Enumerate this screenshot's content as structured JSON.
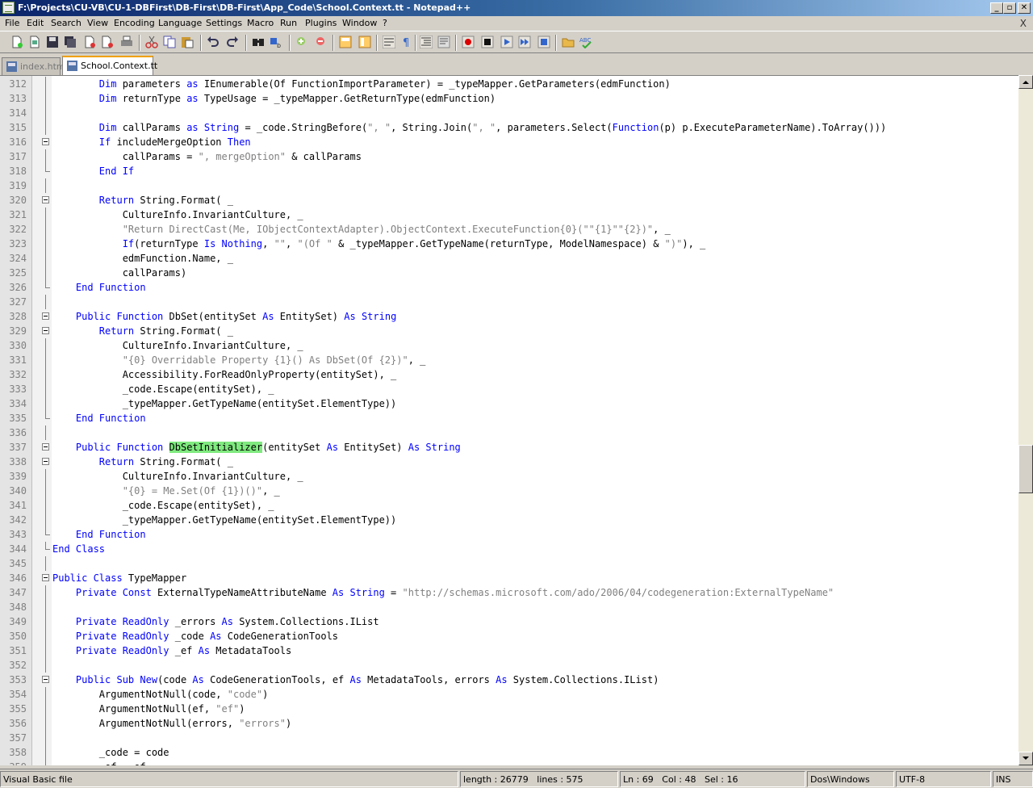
{
  "window": {
    "title": "F:\\Projects\\CU-VB\\CU-1-DBFirst\\DB-First\\DB-First\\App_Code\\School.Context.tt - Notepad++"
  },
  "menu": [
    "File",
    "Edit",
    "Search",
    "View",
    "Encoding",
    "Language",
    "Settings",
    "Macro",
    "Run",
    "Plugins",
    "Window",
    "?"
  ],
  "menu_close": "X",
  "tabs": [
    {
      "label": "index.htm",
      "active": false
    },
    {
      "label": "School.Context.tt",
      "active": true
    }
  ],
  "editor": {
    "lines": [
      {
        "n": "312",
        "segs": [
          [
            "        ",
            ""
          ],
          [
            "Dim",
            "kw"
          ],
          [
            " parameters ",
            ""
          ],
          [
            "as",
            "kw"
          ],
          [
            " IEnumerable(Of FunctionImportParameter) = _typeMapper.GetParameters(edmFunction)",
            ""
          ]
        ]
      },
      {
        "n": "313",
        "segs": [
          [
            "        ",
            ""
          ],
          [
            "Dim",
            "kw"
          ],
          [
            " returnType ",
            ""
          ],
          [
            "as",
            "kw"
          ],
          [
            " TypeUsage = _typeMapper.GetReturnType(edmFunction)",
            ""
          ]
        ]
      },
      {
        "n": "314",
        "segs": []
      },
      {
        "n": "315",
        "segs": [
          [
            "        ",
            ""
          ],
          [
            "Dim",
            "kw"
          ],
          [
            " callParams ",
            ""
          ],
          [
            "as",
            "kw"
          ],
          [
            " ",
            ""
          ],
          [
            "String",
            "kw"
          ],
          [
            " = _code.StringBefore(",
            ""
          ],
          [
            "\", \"",
            "st"
          ],
          [
            ", String.Join(",
            ""
          ],
          [
            "\", \"",
            "st"
          ],
          [
            ", parameters.Select(",
            ""
          ],
          [
            "Function",
            "kw"
          ],
          [
            "(p) p.ExecuteParameterName).ToArray()))",
            ""
          ]
        ]
      },
      {
        "n": "316",
        "segs": [
          [
            "        ",
            ""
          ],
          [
            "If",
            "kw"
          ],
          [
            " includeMergeOption ",
            ""
          ],
          [
            "Then",
            "kw"
          ]
        ]
      },
      {
        "n": "317",
        "segs": [
          [
            "            callParams = ",
            ""
          ],
          [
            "\", mergeOption\"",
            "st"
          ],
          [
            " & callParams",
            ""
          ]
        ]
      },
      {
        "n": "318",
        "segs": [
          [
            "        ",
            ""
          ],
          [
            "End If",
            "kw"
          ]
        ]
      },
      {
        "n": "319",
        "segs": []
      },
      {
        "n": "320",
        "segs": [
          [
            "        ",
            ""
          ],
          [
            "Return",
            "kw"
          ],
          [
            " String.Format( _",
            ""
          ]
        ]
      },
      {
        "n": "321",
        "segs": [
          [
            "            CultureInfo.InvariantCulture, _",
            ""
          ]
        ]
      },
      {
        "n": "322",
        "segs": [
          [
            "            ",
            ""
          ],
          [
            "\"Return DirectCast(Me, IObjectContextAdapter).ObjectContext.ExecuteFunction{0}(\"\"{1}\"\"{2})\"",
            "st"
          ],
          [
            ", _",
            ""
          ]
        ]
      },
      {
        "n": "323",
        "segs": [
          [
            "            ",
            ""
          ],
          [
            "If",
            "kw"
          ],
          [
            "(returnType ",
            ""
          ],
          [
            "Is",
            "kw"
          ],
          [
            " ",
            ""
          ],
          [
            "Nothing",
            "kw"
          ],
          [
            ", ",
            ""
          ],
          [
            "\"\"",
            "st"
          ],
          [
            ", ",
            ""
          ],
          [
            "\"(Of \"",
            "st"
          ],
          [
            " & _typeMapper.GetTypeName(returnType, ModelNamespace) & ",
            ""
          ],
          [
            "\")\"",
            "st"
          ],
          [
            "), _",
            ""
          ]
        ]
      },
      {
        "n": "324",
        "segs": [
          [
            "            edmFunction.Name, _",
            ""
          ]
        ]
      },
      {
        "n": "325",
        "segs": [
          [
            "            callParams)",
            ""
          ]
        ]
      },
      {
        "n": "326",
        "segs": [
          [
            "    ",
            ""
          ],
          [
            "End Function",
            "kw"
          ]
        ]
      },
      {
        "n": "327",
        "segs": []
      },
      {
        "n": "328",
        "segs": [
          [
            "    ",
            ""
          ],
          [
            "Public Function",
            "kw"
          ],
          [
            " DbSet(entitySet ",
            ""
          ],
          [
            "As",
            "kw"
          ],
          [
            " EntitySet) ",
            ""
          ],
          [
            "As String",
            "kw"
          ]
        ]
      },
      {
        "n": "329",
        "segs": [
          [
            "        ",
            ""
          ],
          [
            "Return",
            "kw"
          ],
          [
            " String.Format( _",
            ""
          ]
        ]
      },
      {
        "n": "330",
        "segs": [
          [
            "            CultureInfo.InvariantCulture, _",
            ""
          ]
        ]
      },
      {
        "n": "331",
        "segs": [
          [
            "            ",
            ""
          ],
          [
            "\"{0} Overridable Property {1}() As DbSet(Of {2})\"",
            "st"
          ],
          [
            ", _",
            ""
          ]
        ]
      },
      {
        "n": "332",
        "segs": [
          [
            "            Accessibility.ForReadOnlyProperty(entitySet), _",
            ""
          ]
        ]
      },
      {
        "n": "333",
        "segs": [
          [
            "            _code.Escape(entitySet), _",
            ""
          ]
        ]
      },
      {
        "n": "334",
        "segs": [
          [
            "            _typeMapper.GetTypeName(entitySet.ElementType))",
            ""
          ]
        ]
      },
      {
        "n": "335",
        "segs": [
          [
            "    ",
            ""
          ],
          [
            "End Function",
            "kw"
          ]
        ]
      },
      {
        "n": "336",
        "segs": []
      },
      {
        "n": "337",
        "segs": [
          [
            "    ",
            ""
          ],
          [
            "Public Function",
            "kw"
          ],
          [
            " ",
            ""
          ],
          [
            "DbSetInitializer",
            "hl"
          ],
          [
            "(entitySet ",
            ""
          ],
          [
            "As",
            "kw"
          ],
          [
            " EntitySet) ",
            ""
          ],
          [
            "As String",
            "kw"
          ]
        ]
      },
      {
        "n": "338",
        "segs": [
          [
            "        ",
            ""
          ],
          [
            "Return",
            "kw"
          ],
          [
            " String.Format( _",
            ""
          ]
        ]
      },
      {
        "n": "339",
        "segs": [
          [
            "            CultureInfo.InvariantCulture, _",
            ""
          ]
        ]
      },
      {
        "n": "340",
        "segs": [
          [
            "            ",
            ""
          ],
          [
            "\"{0} = Me.Set(Of {1})()\"",
            "st"
          ],
          [
            ", _",
            ""
          ]
        ]
      },
      {
        "n": "341",
        "segs": [
          [
            "            _code.Escape(entitySet), _",
            ""
          ]
        ]
      },
      {
        "n": "342",
        "segs": [
          [
            "            _typeMapper.GetTypeName(entitySet.ElementType))",
            ""
          ]
        ]
      },
      {
        "n": "343",
        "segs": [
          [
            "    ",
            ""
          ],
          [
            "End Function",
            "kw"
          ]
        ]
      },
      {
        "n": "344",
        "segs": [
          [
            "",
            ""
          ],
          [
            "End Class",
            "kw"
          ]
        ]
      },
      {
        "n": "345",
        "segs": []
      },
      {
        "n": "346",
        "segs": [
          [
            "",
            ""
          ],
          [
            "Public Class",
            "kw"
          ],
          [
            " TypeMapper",
            ""
          ]
        ]
      },
      {
        "n": "347",
        "segs": [
          [
            "    ",
            ""
          ],
          [
            "Private Const",
            "kw"
          ],
          [
            " ExternalTypeNameAttributeName ",
            ""
          ],
          [
            "As String",
            "kw"
          ],
          [
            " = ",
            ""
          ],
          [
            "\"http://schemas.microsoft.com/ado/2006/04/codegeneration:ExternalTypeName\"",
            "st"
          ]
        ]
      },
      {
        "n": "348",
        "segs": []
      },
      {
        "n": "349",
        "segs": [
          [
            "    ",
            ""
          ],
          [
            "Private ReadOnly",
            "kw"
          ],
          [
            " _errors ",
            ""
          ],
          [
            "As",
            "kw"
          ],
          [
            " System.Collections.IList",
            ""
          ]
        ]
      },
      {
        "n": "350",
        "segs": [
          [
            "    ",
            ""
          ],
          [
            "Private ReadOnly",
            "kw"
          ],
          [
            " _code ",
            ""
          ],
          [
            "As",
            "kw"
          ],
          [
            " CodeGenerationTools",
            ""
          ]
        ]
      },
      {
        "n": "351",
        "segs": [
          [
            "    ",
            ""
          ],
          [
            "Private ReadOnly",
            "kw"
          ],
          [
            " _ef ",
            ""
          ],
          [
            "As",
            "kw"
          ],
          [
            " MetadataTools",
            ""
          ]
        ]
      },
      {
        "n": "352",
        "segs": []
      },
      {
        "n": "353",
        "segs": [
          [
            "    ",
            ""
          ],
          [
            "Public Sub New",
            "kw"
          ],
          [
            "(code ",
            ""
          ],
          [
            "As",
            "kw"
          ],
          [
            " CodeGenerationTools, ef ",
            ""
          ],
          [
            "As",
            "kw"
          ],
          [
            " MetadataTools, errors ",
            ""
          ],
          [
            "As",
            "kw"
          ],
          [
            " System.Collections.IList)",
            ""
          ]
        ]
      },
      {
        "n": "354",
        "segs": [
          [
            "        ArgumentNotNull(code, ",
            ""
          ],
          [
            "\"code\"",
            "st"
          ],
          [
            ")",
            ""
          ]
        ]
      },
      {
        "n": "355",
        "segs": [
          [
            "        ArgumentNotNull(ef, ",
            ""
          ],
          [
            "\"ef\"",
            "st"
          ],
          [
            ")",
            ""
          ]
        ]
      },
      {
        "n": "356",
        "segs": [
          [
            "        ArgumentNotNull(errors, ",
            ""
          ],
          [
            "\"errors\"",
            "st"
          ],
          [
            ")",
            ""
          ]
        ]
      },
      {
        "n": "357",
        "segs": []
      },
      {
        "n": "358",
        "segs": [
          [
            "        _code = code",
            ""
          ]
        ]
      },
      {
        "n": "359",
        "segs": [
          [
            "        _ef = ef",
            ""
          ]
        ]
      }
    ]
  },
  "status": {
    "filetype": "Visual Basic file",
    "length": "length : 26779",
    "lines": "lines : 575",
    "ln": "Ln : 69",
    "col": "Col : 48",
    "sel": "Sel : 16",
    "eol": "Dos\\Windows",
    "encoding": "UTF-8",
    "mode": "INS"
  },
  "icons": [
    "new-icon",
    "open-icon",
    "save-icon",
    "save-all-icon",
    "close-icon",
    "close-all-icon",
    "print-icon",
    "cut-icon",
    "copy-icon",
    "paste-icon",
    "undo-icon",
    "redo-icon",
    "find-icon",
    "replace-icon",
    "zoom-in-icon",
    "zoom-out-icon",
    "sync-v-icon",
    "sync-h-icon",
    "word-wrap-icon",
    "show-all-chars-icon",
    "indent-guide-icon",
    "record-macro-icon",
    "stop-record-icon",
    "play-macro-icon",
    "run-macro-multiple-icon",
    "save-macro-icon",
    "folder-icon",
    "spellcheck-icon"
  ]
}
